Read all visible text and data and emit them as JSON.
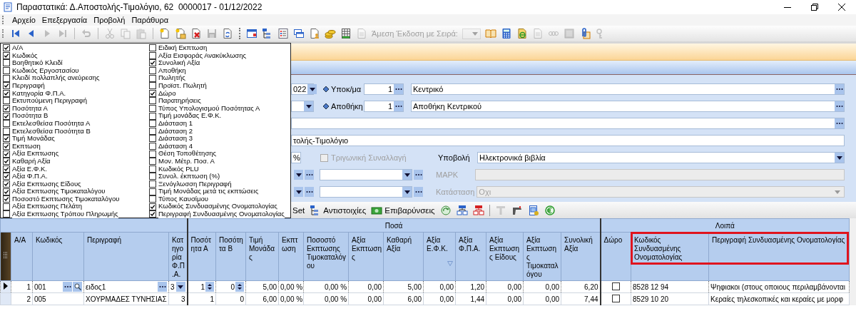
{
  "window": {
    "title": "Παραστατικά: Δ.Αποστολής-Τιμολόγιο, 62  0000017 - 01/12/2022"
  },
  "menu": [
    "Αρχείο",
    "Επεξεργασία",
    "Προβολή",
    "Παράθυρα"
  ],
  "toolbar": {
    "groups": [
      [
        {
          "kind": "first",
          "disabled": false
        },
        {
          "kind": "prev",
          "disabled": false
        },
        {
          "kind": "next",
          "disabled": true
        },
        {
          "kind": "last",
          "disabled": true
        }
      ],
      [
        {
          "kind": "undo",
          "disabled": true
        }
      ],
      [
        {
          "kind": "cut",
          "disabled": true
        },
        {
          "kind": "copy",
          "disabled": true
        },
        {
          "kind": "paste",
          "disabled": true
        }
      ],
      [
        {
          "kind": "new",
          "disabled": false
        },
        {
          "kind": "new-folder",
          "disabled": false
        },
        {
          "kind": "delete",
          "disabled": false
        },
        {
          "kind": "save",
          "disabled": true
        },
        {
          "kind": "refresh",
          "disabled": false
        }
      ],
      [
        {
          "kind": "window",
          "disabled": false
        },
        {
          "kind": "tree",
          "disabled": false
        },
        {
          "kind": "list",
          "disabled": false
        },
        {
          "kind": "windows",
          "disabled": false
        },
        {
          "kind": "doc-person",
          "disabled": false
        },
        {
          "kind": "coins",
          "disabled": false
        },
        {
          "kind": "grid",
          "disabled": false
        },
        {
          "kind": "doc",
          "disabled": true
        },
        {
          "kind": "label",
          "text": "Άμεση Έκδοση με Σειρά:",
          "disabled": true
        },
        {
          "kind": "combo",
          "disabled": true
        },
        {
          "kind": "book",
          "disabled": false
        },
        {
          "kind": "calculator",
          "disabled": false
        },
        {
          "kind": "doc-e",
          "disabled": false
        },
        {
          "kind": "doc",
          "disabled": true
        },
        {
          "kind": "chain",
          "disabled": true
        },
        {
          "kind": "square",
          "disabled": true
        },
        {
          "kind": "clip",
          "disabled": false
        },
        {
          "kind": "key",
          "disabled": true
        }
      ]
    ]
  },
  "column_chooser": {
    "lists": [
      {
        "items": [
          {
            "label": "Α/Α",
            "checked": true
          },
          {
            "label": "Κωδικός",
            "checked": true
          },
          {
            "label": "Βοηθητικό Κλειδί",
            "checked": false
          },
          {
            "label": "Κωδικός Εργοστασίου",
            "checked": false
          },
          {
            "label": "Κλειδί πολλαπλής ανεύρεσης",
            "checked": false
          },
          {
            "label": "Περιγραφή",
            "checked": true
          },
          {
            "label": "Κατηγορία Φ.Π.Α.",
            "checked": true
          },
          {
            "label": "Εκτυπούμενη Περιγραφή",
            "checked": false
          },
          {
            "label": "Ποσότητα Α",
            "checked": true
          },
          {
            "label": "Ποσότητα Β",
            "checked": true
          },
          {
            "label": "Εκτελεσθείσα Ποσότητα Α",
            "checked": false
          },
          {
            "label": "Εκτελεσθείσα Ποσότητα Β",
            "checked": false
          },
          {
            "label": "Τιμή Μονάδας",
            "checked": true
          },
          {
            "label": "Εκπτωση",
            "checked": true
          },
          {
            "label": "Αξία Εκπτωσης",
            "checked": true
          },
          {
            "label": "Καθαρή Αξία",
            "checked": true
          },
          {
            "label": "Αξία Ε.Φ.Κ.",
            "checked": true
          },
          {
            "label": "Αξία Φ.Π.Α.",
            "checked": true
          },
          {
            "label": "Αξία Εκπτωσης Είδους",
            "checked": true
          },
          {
            "label": "Αξία Εκπτωσης Τιμοκαταλόγου",
            "checked": true
          },
          {
            "label": "Ποσοστό Εκπτωσης Τιμοκαταλόγου",
            "checked": true
          },
          {
            "label": "Αξία Εκπτωσης Πελάτη",
            "checked": false
          },
          {
            "label": "Αξία Εκπτωσης Τρόπου Πληρωμής",
            "checked": false
          }
        ]
      },
      {
        "items": [
          {
            "label": "Ειδική Εκπτωση",
            "checked": false
          },
          {
            "label": "Αξία Εισφοράς Ανακύκλωσης",
            "checked": false
          },
          {
            "label": "Συνολική Αξία",
            "checked": true
          },
          {
            "label": "Αποθήκη",
            "checked": false
          },
          {
            "label": "Πωλητής",
            "checked": false
          },
          {
            "label": "Προϊστ. Πωλητή",
            "checked": false
          },
          {
            "label": "Δώρο",
            "checked": true
          },
          {
            "label": "Παρατηρήσεις",
            "checked": false
          },
          {
            "label": "Τύπος Υπολογισμού Ποσότητας Α",
            "checked": false
          },
          {
            "label": "Τιμή μονάδας Ε.Φ.Κ.",
            "checked": false
          },
          {
            "label": "Διάσταση 1",
            "checked": false
          },
          {
            "label": "Διάσταση 2",
            "checked": false
          },
          {
            "label": "Διάσταση 3",
            "checked": false
          },
          {
            "label": "Διάσταση 4",
            "checked": false
          },
          {
            "label": "Θέση Τοποθέτησης",
            "checked": false
          },
          {
            "label": "Μον. Μέτρ. Ποσ. Α",
            "checked": false
          },
          {
            "label": "Κωδικός PLU",
            "checked": false
          },
          {
            "label": "Συνολ. έκπτωση (%)",
            "checked": false
          },
          {
            "label": "Ξενόγλωσση Περιγραφή",
            "checked": false
          },
          {
            "label": "Τιμή Μονάδας μετά τις εκπτώσεις",
            "checked": false
          },
          {
            "label": "Τύπος Καυσίμου",
            "checked": false
          },
          {
            "label": "Κωδικός Συνδυασμένης Ονοματολογίας",
            "checked": true
          },
          {
            "label": "Περιγραφή Συνδυασμένης Ονοματολογίας",
            "checked": true
          }
        ]
      }
    ]
  },
  "form": {
    "date_tail": "022",
    "branch": {
      "label": "Υποκ/μα",
      "code": "1",
      "name": "Κεντρικό"
    },
    "warehouse": {
      "label": "Αποθήκη",
      "code": "1",
      "name": "Αποθήκη Κεντρικού"
    },
    "series_tail": "τολής-Τιμολόγιο",
    "percent": "%",
    "triangular": {
      "label": "Τριγωνική Συναλλαγή",
      "checked": false,
      "disabled": true
    },
    "submission": {
      "label": "Υποβολή",
      "value": "Ηλεκτρονικά βιβλία"
    },
    "mark": {
      "label": "ΜΑΡΚ",
      "disabled": true
    },
    "status": {
      "label": "Κατάσταση",
      "value": "Οχι",
      "disabled": true
    }
  },
  "lines_toolbar": [
    {
      "kind": "plain",
      "text": "Set",
      "disabled": false
    },
    {
      "kind": "tree",
      "text": "Αντιστοιχίες",
      "disabled": false
    },
    {
      "kind": "money",
      "text": "Επιβαρύνσεις",
      "disabled": false
    },
    {
      "kind": "recycle",
      "disabled": false
    },
    {
      "kind": "tree-blue",
      "disabled": false
    },
    {
      "kind": "tree-red",
      "disabled": false
    },
    {
      "kind": "tee",
      "disabled": true
    },
    {
      "kind": "scanner",
      "disabled": false
    },
    {
      "kind": "doc-grid",
      "disabled": false
    },
    {
      "kind": "euro",
      "disabled": false
    }
  ],
  "table": {
    "column_groups": [
      {
        "columns": [
          {
            "label": "Α/Α",
            "kind": "number",
            "filter": false,
            "highlighted": false
          },
          {
            "label": "Κωδικός",
            "kind": "lookup-search",
            "filter": false,
            "highlighted": false
          },
          {
            "label": "Περιγραφή",
            "kind": "lookup",
            "filter": false,
            "highlighted": false
          },
          {
            "label": "Κατηγορία Φ.Π.Α.",
            "kind": "combo",
            "filter": false,
            "highlighted": false
          }
        ]
      },
      {
        "label": "Ποσά",
        "columns": [
          {
            "label": "Ποσότητα Α",
            "kind": "spin",
            "filter": false,
            "highlighted": false
          },
          {
            "label": "Ποσότητα Β",
            "kind": "spin",
            "filter": false,
            "highlighted": false
          },
          {
            "label": "Τιμή Μονάδας",
            "kind": "number",
            "filter": false,
            "highlighted": false
          },
          {
            "label": "Εκπτωση",
            "kind": "number",
            "filter": false,
            "highlighted": false
          },
          {
            "label": "Ποσοστό Εκπτωσης Τιμοκαταλόγου",
            "kind": "number",
            "filter": false,
            "highlighted": false
          },
          {
            "label": "Αξία Εκπτωσης",
            "kind": "number",
            "filter": false,
            "highlighted": false
          },
          {
            "label": "Καθαρή Αξία",
            "kind": "number",
            "filter": false,
            "highlighted": false
          },
          {
            "label": "Αξία Ε.Φ.Κ.",
            "kind": "number",
            "filter": true,
            "highlighted": false
          },
          {
            "label": "Αξία Φ.Π.Α.",
            "kind": "number",
            "filter": false,
            "highlighted": false
          },
          {
            "label": "Αξία Εκπτωσης Είδους",
            "kind": "number",
            "filter": false,
            "highlighted": false
          },
          {
            "label": "Αξία Εκπτωσης Τιμοκαταλόγου",
            "kind": "number",
            "filter": false,
            "highlighted": false
          },
          {
            "label": "Συνολική Αξία",
            "kind": "number",
            "filter": false,
            "highlighted": false
          }
        ]
      },
      {
        "label": "Λοιπά",
        "columns": [
          {
            "label": "Δώρο",
            "kind": "check",
            "filter": false,
            "highlighted": false
          },
          {
            "label": "Κωδικός Συνδυασμένης Ονοματολογίας",
            "kind": "text",
            "filter": false,
            "highlighted": true
          },
          {
            "label": "Περιγραφή Συνδυασμένης Ονοματολογίας",
            "kind": "text",
            "filter": false,
            "highlighted": true
          }
        ]
      }
    ],
    "rows": [
      {
        "selected": true,
        "cells": [
          "1",
          "001",
          "ειδος1",
          "3",
          "1",
          "0",
          "5,00",
          "0,00 %",
          "0,00 %",
          "0,00",
          "5,00",
          "0,00",
          "1,20",
          "0,00",
          "0,00",
          "6,20",
          false,
          "8528 12 94",
          "Ψηφιακοι (στους οποιους περιλαμβάνονται"
        ]
      },
      {
        "selected": false,
        "cells": [
          "2",
          "005",
          "ΧΟΥΡΜΑΔΕΣ ΤΥΝΗΣΙΑΣ",
          "3",
          "1",
          "0",
          "6,00",
          "0,00 %",
          "0,00 %",
          "0,00",
          "6,00",
          "0,00",
          "1,44",
          "0,00",
          "0,00",
          "7,44",
          false,
          "8529 10 20",
          "Κεραίες τηλεσκοπικές και κεραίες με μορφ"
        ]
      }
    ]
  }
}
